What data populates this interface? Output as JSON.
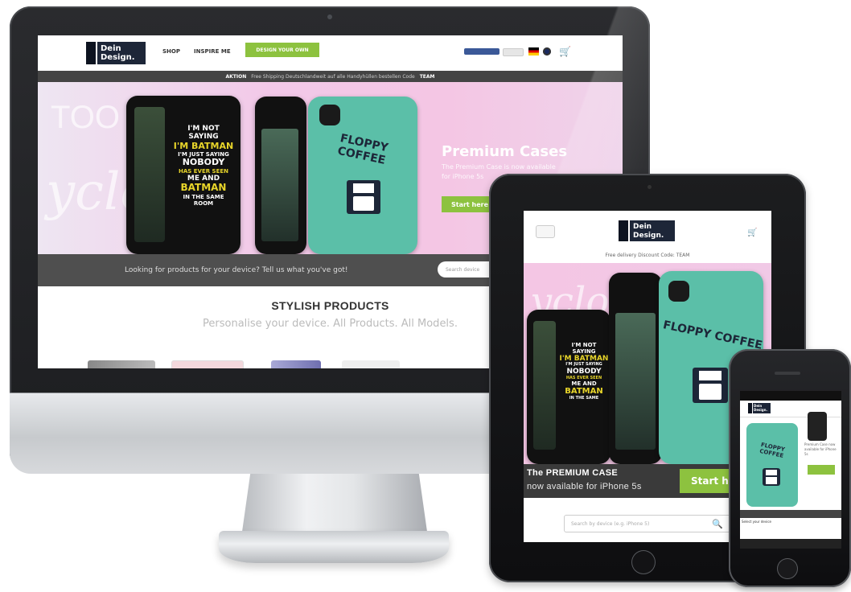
{
  "brand": {
    "line1": "Dein",
    "line2": "Design."
  },
  "desktop": {
    "nav": {
      "shop": "SHOP",
      "inspire": "INSPIRE ME",
      "cta": "DESIGN YOUR OWN"
    },
    "promo": {
      "label": "AKTION",
      "text": "Free Shipping  Deutschlandweit auf alle Handyhüllen bestellen  Code",
      "code": "TEAM"
    },
    "hero": {
      "ghost_1": "TOO B",
      "ghost_2": "yclo",
      "case_text": [
        "I'M NOT SAYING",
        "I'M BATMAN",
        "I'M JUST SAYING",
        "NOBODY",
        "HAS EVER SEEN",
        "ME AND",
        "BATMAN",
        "IN THE SAME",
        "ROOM"
      ],
      "floppy_title": "FLOPPY COFFEE",
      "premium_title": "Premium Cases",
      "premium_sub": "The Premium Case is now available for iPhone 5s",
      "start": "Start here"
    },
    "search": {
      "text": "Looking for products for your device? Tell us what you've got!",
      "placeholder": "Search device"
    },
    "stylish": {
      "title": "STYLISH PRODUCTS",
      "subtitle": "Personalise your device. All Products. All Models."
    }
  },
  "tablet": {
    "promo": "Free delivery  Discount Code: TEAM",
    "banner_title": "The PREMIUM CASE",
    "banner_sub": "now available for iPhone 5s",
    "start": "Start he",
    "search_placeholder": "Search by device (e.g. iPhone 5)",
    "floppy_title": "FLOPPY COFFEE"
  },
  "mobile": {
    "side_text": "Premium Case  now available for iPhone 5s",
    "select": "Select your device"
  },
  "colors": {
    "brand_navy": "#1d2638",
    "accent_green": "#8dc23f",
    "teal_case": "#5bbfa8",
    "hero_pink": "#f4c6e4"
  }
}
